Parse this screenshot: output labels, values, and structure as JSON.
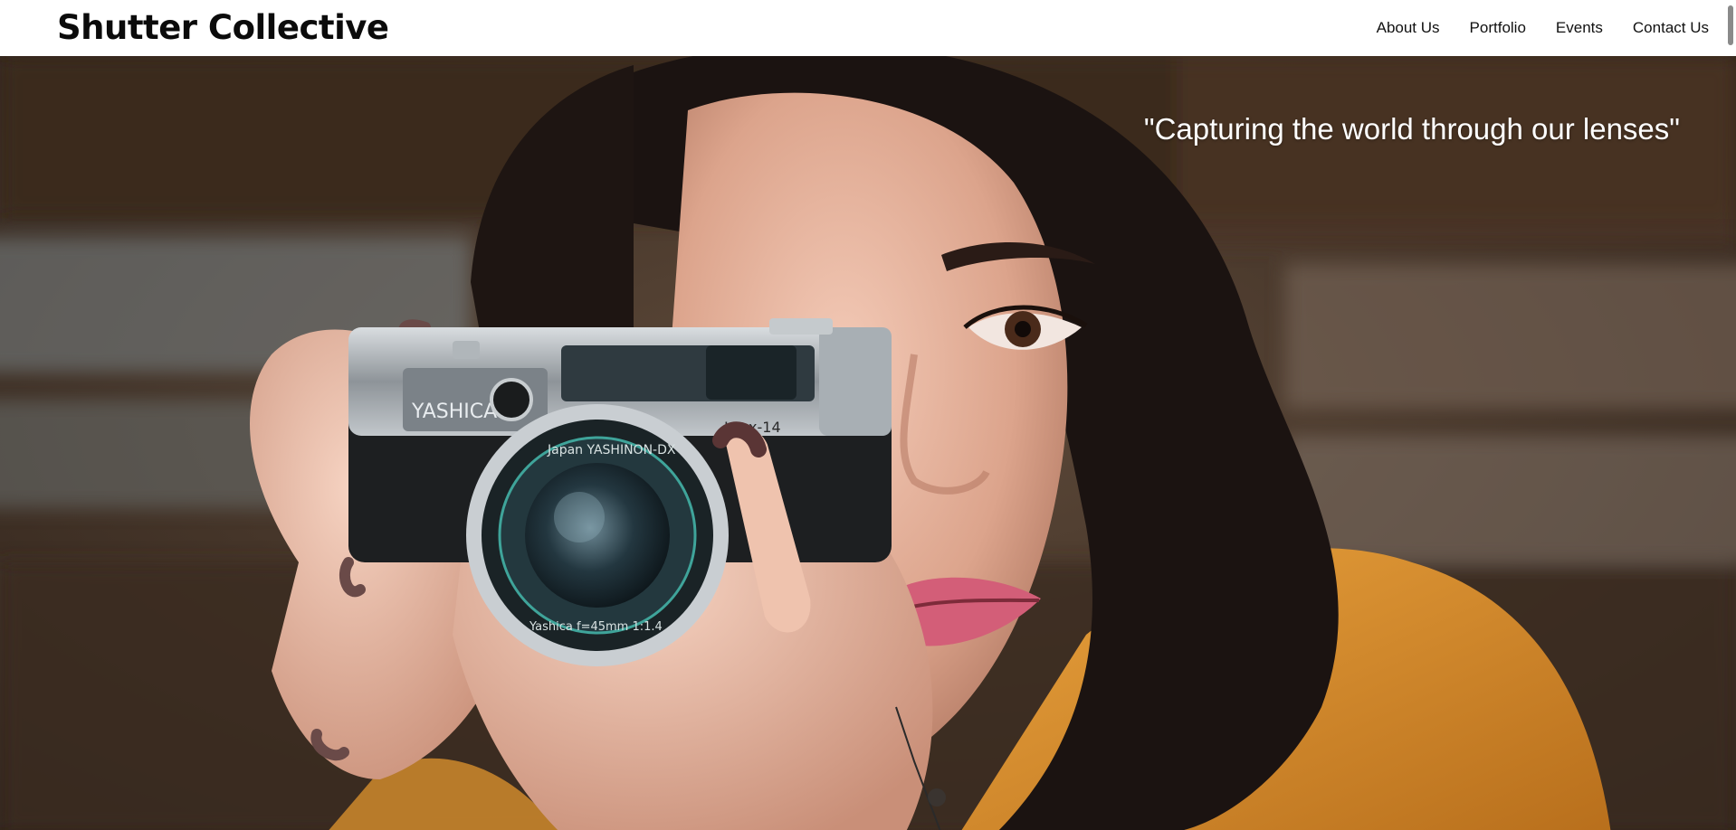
{
  "header": {
    "brand": "Shutter Collective",
    "nav": [
      {
        "label": "About Us"
      },
      {
        "label": "Portfolio"
      },
      {
        "label": "Events"
      },
      {
        "label": "Contact Us"
      }
    ]
  },
  "hero": {
    "quote": "\"Capturing the world through our lenses\"",
    "camera_brand": "YASHICA",
    "camera_model": "Lynx-14",
    "lens_ring_text": "Japan YASHINON-DX",
    "lens_ring_text_2": "Yashica f=45mm 1:1.4"
  },
  "colors": {
    "header_bg": "#ffffff",
    "brand_text": "#0b0b0b",
    "quote_text": "#ffffff",
    "jacket_orange": "#d9902e"
  }
}
